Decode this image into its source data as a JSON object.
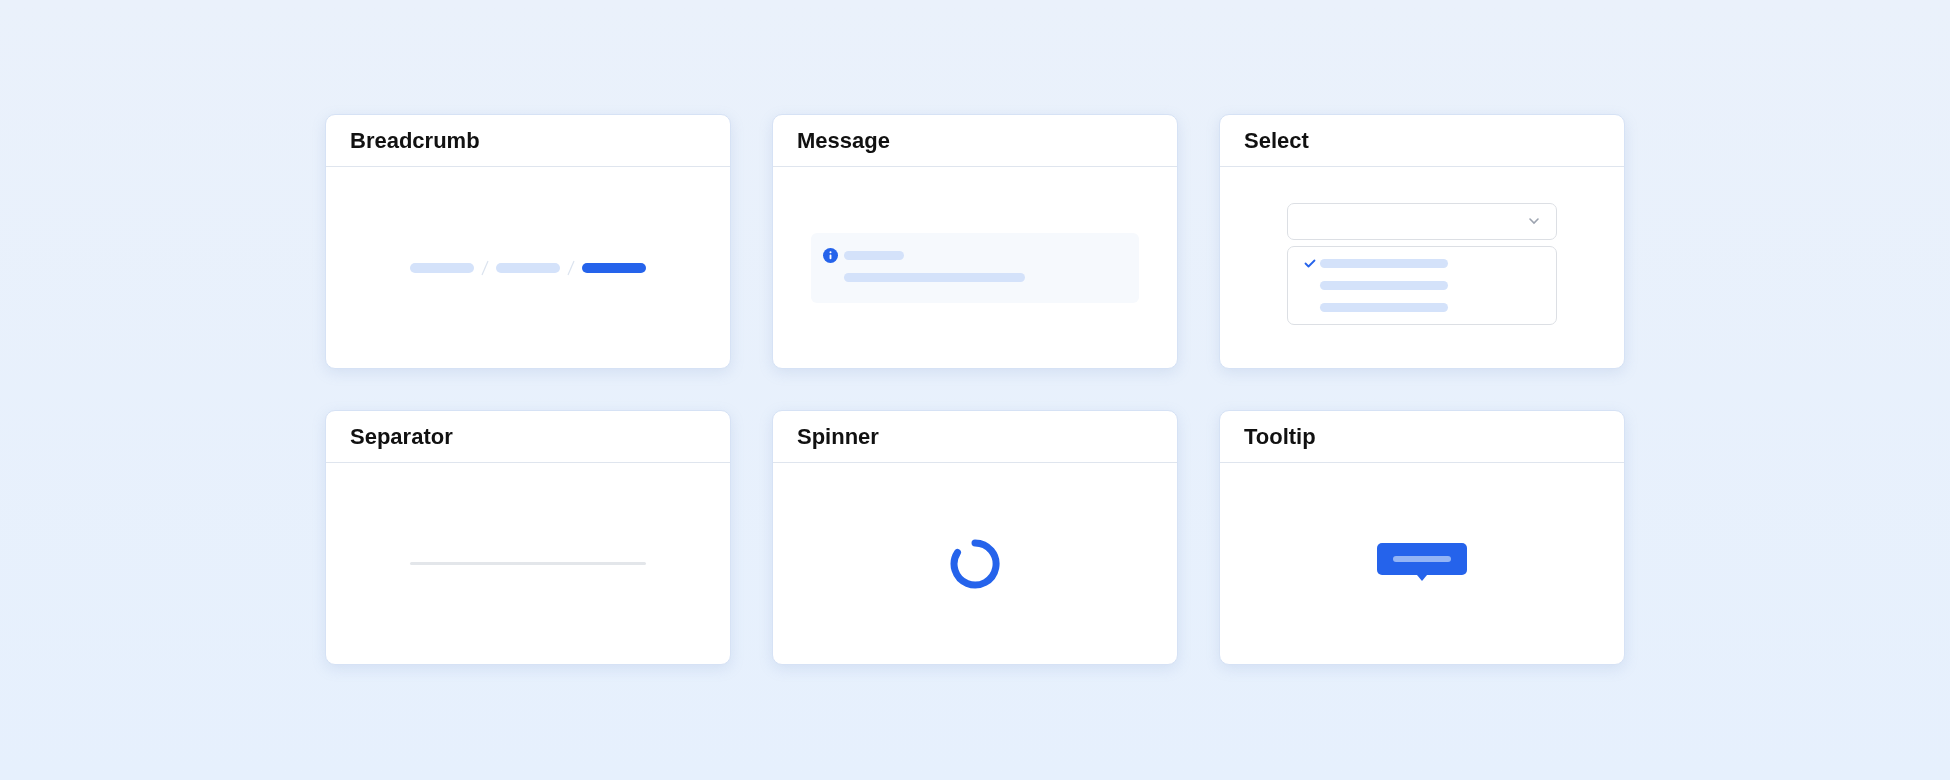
{
  "cards": [
    {
      "title": "Breadcrumb",
      "kind": "breadcrumb",
      "crumbs": [
        {
          "current": false
        },
        {
          "current": false
        },
        {
          "current": true
        }
      ]
    },
    {
      "title": "Message",
      "kind": "message"
    },
    {
      "title": "Select",
      "kind": "select",
      "options": [
        {
          "selected": true
        },
        {
          "selected": false
        },
        {
          "selected": false
        }
      ]
    },
    {
      "title": "Separator",
      "kind": "separator"
    },
    {
      "title": "Spinner",
      "kind": "spinner"
    },
    {
      "title": "Tooltip",
      "kind": "tooltip"
    }
  ]
}
